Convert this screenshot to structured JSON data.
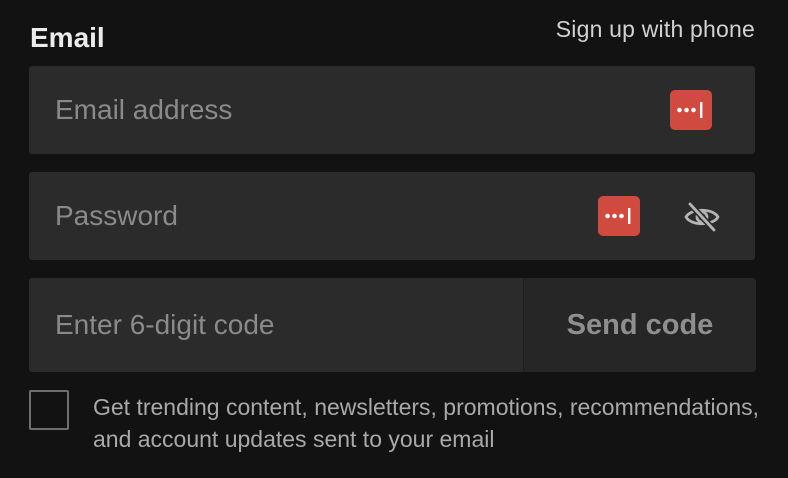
{
  "form": {
    "title": "Email",
    "switch_link": "Sign up with phone",
    "email": {
      "placeholder": "Email address",
      "value": "",
      "password_manager_icon": "password-manager-icon"
    },
    "password": {
      "placeholder": "Password",
      "value": "",
      "password_manager_icon": "password-manager-icon",
      "visibility_icon": "eye-slash-icon"
    },
    "code": {
      "placeholder": "Enter 6-digit code",
      "value": "",
      "send_button": "Send code"
    },
    "consent": {
      "checked": false,
      "text": "Get trending content, newsletters, promotions, recommendations, and account updates sent to your email"
    }
  },
  "colors": {
    "background": "#121212",
    "field_background": "#2b2b2b",
    "password_manager_accent": "#d14a3f",
    "placeholder": "#8a8a8a"
  }
}
